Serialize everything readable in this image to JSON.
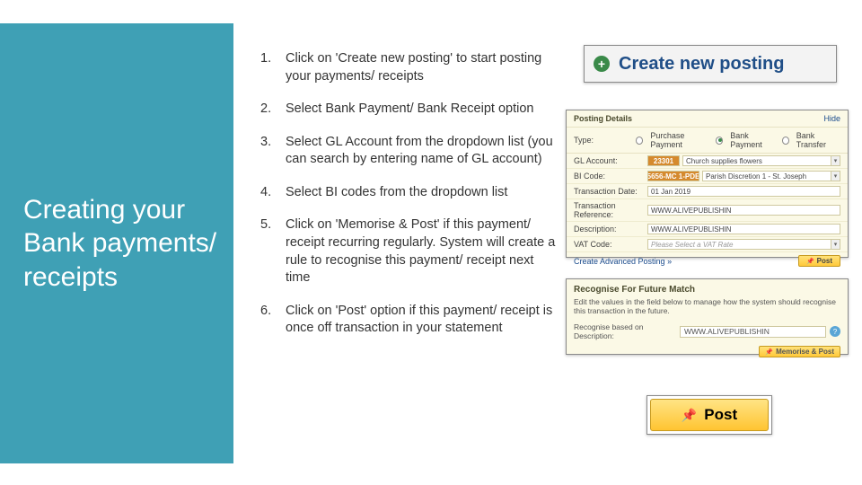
{
  "sidebar": {
    "title": "Creating your Bank payments/ receipts"
  },
  "steps": [
    {
      "n": "1.",
      "text": "Click on 'Create new posting' to start posting your payments/ receipts"
    },
    {
      "n": "2.",
      "text": "Select Bank Payment/ Bank Receipt option"
    },
    {
      "n": "3.",
      "text": "Select GL Account from the dropdown list (you can search by entering name of GL account)"
    },
    {
      "n": "4.",
      "text": "Select BI codes from the dropdown list"
    },
    {
      "n": "5.",
      "text": "Click on 'Memorise & Post' if this payment/ receipt recurring regularly. System will create a rule to recognise this payment/ receipt next time"
    },
    {
      "n": "6.",
      "text": "Click on 'Post' option if this payment/ receipt is once off transaction in your statement"
    }
  ],
  "create": {
    "label": "Create new posting"
  },
  "posting": {
    "header": "Posting Details",
    "hide": "Hide",
    "type_label": "Type:",
    "types": [
      "Purchase Payment",
      "Bank Payment",
      "Bank Transfer"
    ],
    "selected_type": 1,
    "gl_label": "GL Account:",
    "gl_code": "23301",
    "gl_text": "Church supplies flowers",
    "bi_label": "BI Code:",
    "bi_code": "5656-MC 1-PDE",
    "bi_text": "Parish Discretion 1 - St. Joseph",
    "date_label": "Transaction Date:",
    "date_value": "01 Jan 2019",
    "ref_label": "Transaction Reference:",
    "ref_value": "WWW.ALIVEPUBLISHIN",
    "desc_label": "Description:",
    "desc_value": "WWW.ALIVEPUBLISHIN",
    "vat_label": "VAT Code:",
    "vat_value": "Please Select a VAT Rate",
    "adv": "Create Advanced Posting »",
    "post": "Post"
  },
  "recognise": {
    "header": "Recognise For Future Match",
    "sub": "Edit the values in the field below to manage how the system should recognise this transaction in the future.",
    "lbl": "Recognise based on Description:",
    "value": "WWW.ALIVEPUBLISHIN",
    "btn": "Memorise & Post"
  },
  "postbig": {
    "label": "Post"
  }
}
